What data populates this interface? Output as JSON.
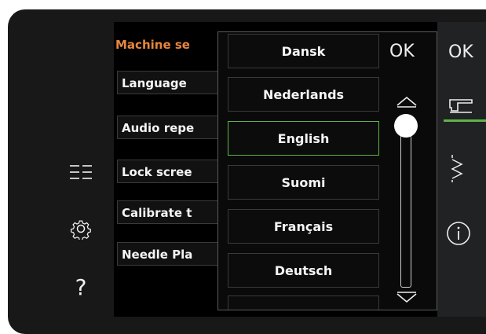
{
  "sidebar": {
    "icons": [
      "list-icon",
      "gear-icon",
      "help-icon"
    ],
    "help_label": "?"
  },
  "settings": {
    "header": "Machine se",
    "rows": [
      "Language",
      "Audio repe",
      "Lock scree",
      "Calibrate t",
      "Needle Pla"
    ]
  },
  "language_dropdown": {
    "ok_label": "OK",
    "options": [
      "Dansk",
      "Nederlands",
      "English",
      "Suomi",
      "Français",
      "Deutsch"
    ],
    "selected": "English"
  },
  "right_panel": {
    "ok_label": "OK",
    "icons": [
      "sewing-machine-icon",
      "stitch-icon",
      "info-icon"
    ]
  },
  "colors": {
    "accent_orange": "#e8873d",
    "selection_green": "#5fb34a",
    "background": "#000000"
  }
}
